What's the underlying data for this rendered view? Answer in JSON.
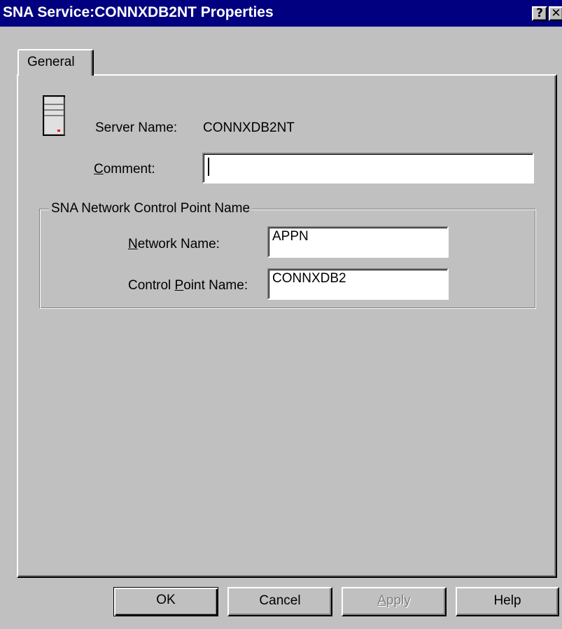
{
  "window": {
    "title": "SNA Service:CONNXDB2NT Properties",
    "help_glyph": "?",
    "close_glyph": "✕"
  },
  "tabs": [
    {
      "label": "General",
      "selected": true
    }
  ],
  "general": {
    "icon": "server-icon",
    "server_name_label": "Server Name:",
    "server_name_value": "CONNXDB2NT",
    "comment_label_mnemonic": "C",
    "comment_label_rest": "omment:",
    "comment_value": "",
    "group_title": "SNA Network Control Point Name",
    "network_name_label_mnemonic": "N",
    "network_name_label_rest": "etwork Name:",
    "network_name_value": "APPN",
    "control_point_label_prefix": "Control ",
    "control_point_label_mnemonic": "P",
    "control_point_label_rest": "oint Name:",
    "control_point_value": "CONNXDB2"
  },
  "buttons": {
    "ok": "OK",
    "cancel": "Cancel",
    "apply_mnemonic": "A",
    "apply_rest": "pply",
    "help": "Help"
  },
  "colors": {
    "titlebar": "#000080",
    "face": "#c0c0c0",
    "field": "#ffffff"
  }
}
